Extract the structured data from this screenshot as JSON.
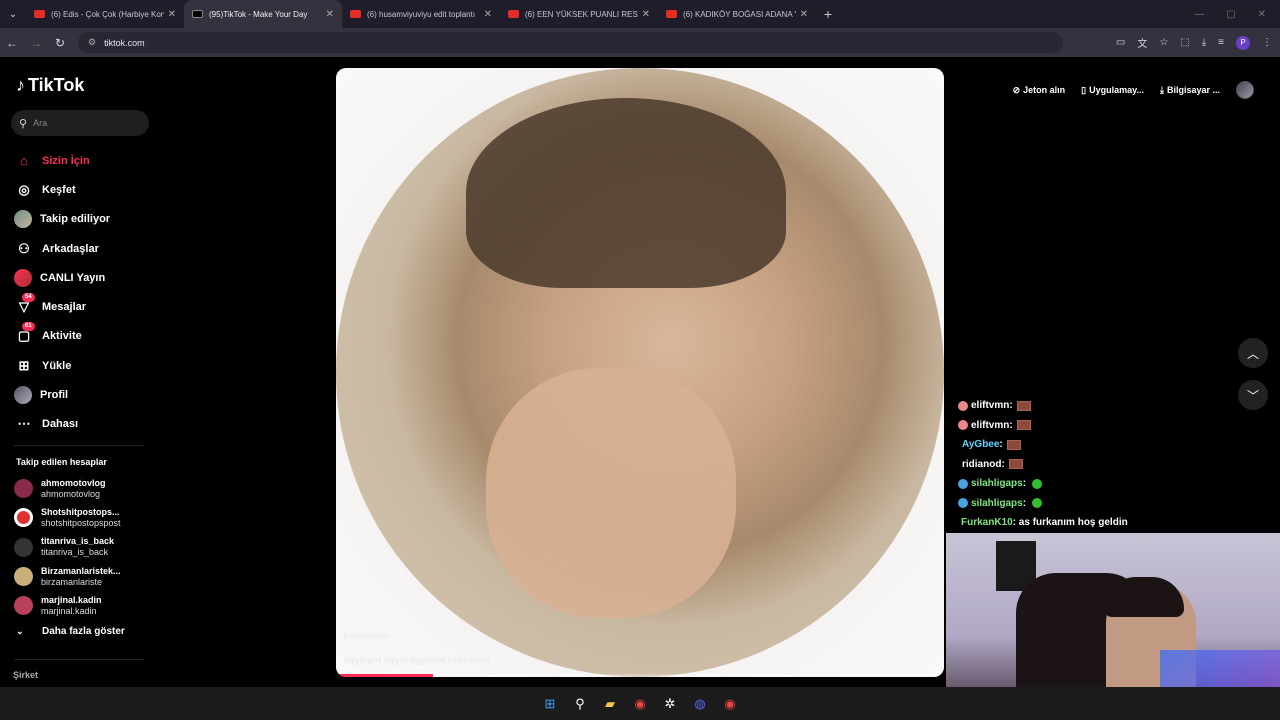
{
  "browser": {
    "tabs": [
      {
        "title": "(6) Edis - Çok Çok (Harbiye Kon"
      },
      {
        "title": "(95)TikTok - Make Your Day"
      },
      {
        "title": "(6) husamviyuviyu edit toplantı"
      },
      {
        "title": "(6) EEN YÜKSEK PUANLI RESTO"
      },
      {
        "title": "(6) KADIKÖY BOĞASI ADANA Y"
      }
    ],
    "new_tab": "+",
    "url": "tiktok.com",
    "profile_initial": "P"
  },
  "tiktok": {
    "logo": "TikTok",
    "search_placeholder": "Ara",
    "nav": [
      {
        "label": "Sizin İçin",
        "icon": "home-icon"
      },
      {
        "label": "Keşfet",
        "icon": "compass-icon"
      },
      {
        "label": "Takip ediliyor",
        "icon": "following-avatar-icon"
      },
      {
        "label": "Arkadaşlar",
        "icon": "friends-icon"
      },
      {
        "label": "CANLI Yayın",
        "icon": "live-icon"
      },
      {
        "label": "Mesajlar",
        "icon": "messages-icon",
        "badge": "54"
      },
      {
        "label": "Aktivite",
        "icon": "activity-icon",
        "badge": "61"
      },
      {
        "label": "Yükle",
        "icon": "upload-icon"
      },
      {
        "label": "Profil",
        "icon": "profile-icon"
      },
      {
        "label": "Dahası",
        "icon": "more-icon"
      }
    ],
    "following_title": "Takip edilen hesaplar",
    "following": [
      {
        "name": "ahmomotovlog",
        "handle": "ahmomotovlog"
      },
      {
        "name": "Shotshitpostops...",
        "handle": "shotshitpostopspost"
      },
      {
        "name": "titanriva_is_back",
        "handle": "titanriva_is_back"
      },
      {
        "name": "Birzamanlaristek...",
        "handle": "birzamanlariste"
      },
      {
        "name": "marjinal.kadin",
        "handle": "marjinal.kadin"
      }
    ],
    "show_more": "Daha fazla göster",
    "company": "Şirket",
    "top_actions": {
      "coins": "Jeton alın",
      "app": "Uygulamay...",
      "desktop": "Bilgisayar ..."
    },
    "video": {
      "author": "karinishon",
      "tags": "#gymgirl #gym #gymrat #кач #зал",
      "progress": 0.16
    }
  },
  "chat": [
    {
      "user": "eliftvmn",
      "sep": " :",
      "emote": "emote"
    },
    {
      "user": "eliftvmn",
      "sep": " :",
      "emote": "emote"
    },
    {
      "user": "AyGbee",
      "sep": " :",
      "emote": "emote"
    },
    {
      "user": "ridianod",
      "sep": " :",
      "emote": "emote"
    },
    {
      "user": "silahligaps",
      "sep": " :",
      "emote": "green"
    },
    {
      "user": "silahligaps",
      "sep": " :",
      "emote": "green"
    },
    {
      "user": "FurkanK10",
      "sep": " : as furkanım hoş geldin",
      "emote": ""
    }
  ],
  "colors": {
    "accent": "#fe2c55",
    "chat_green": "#7de87d",
    "chat_blue": "#5fd3ff"
  }
}
